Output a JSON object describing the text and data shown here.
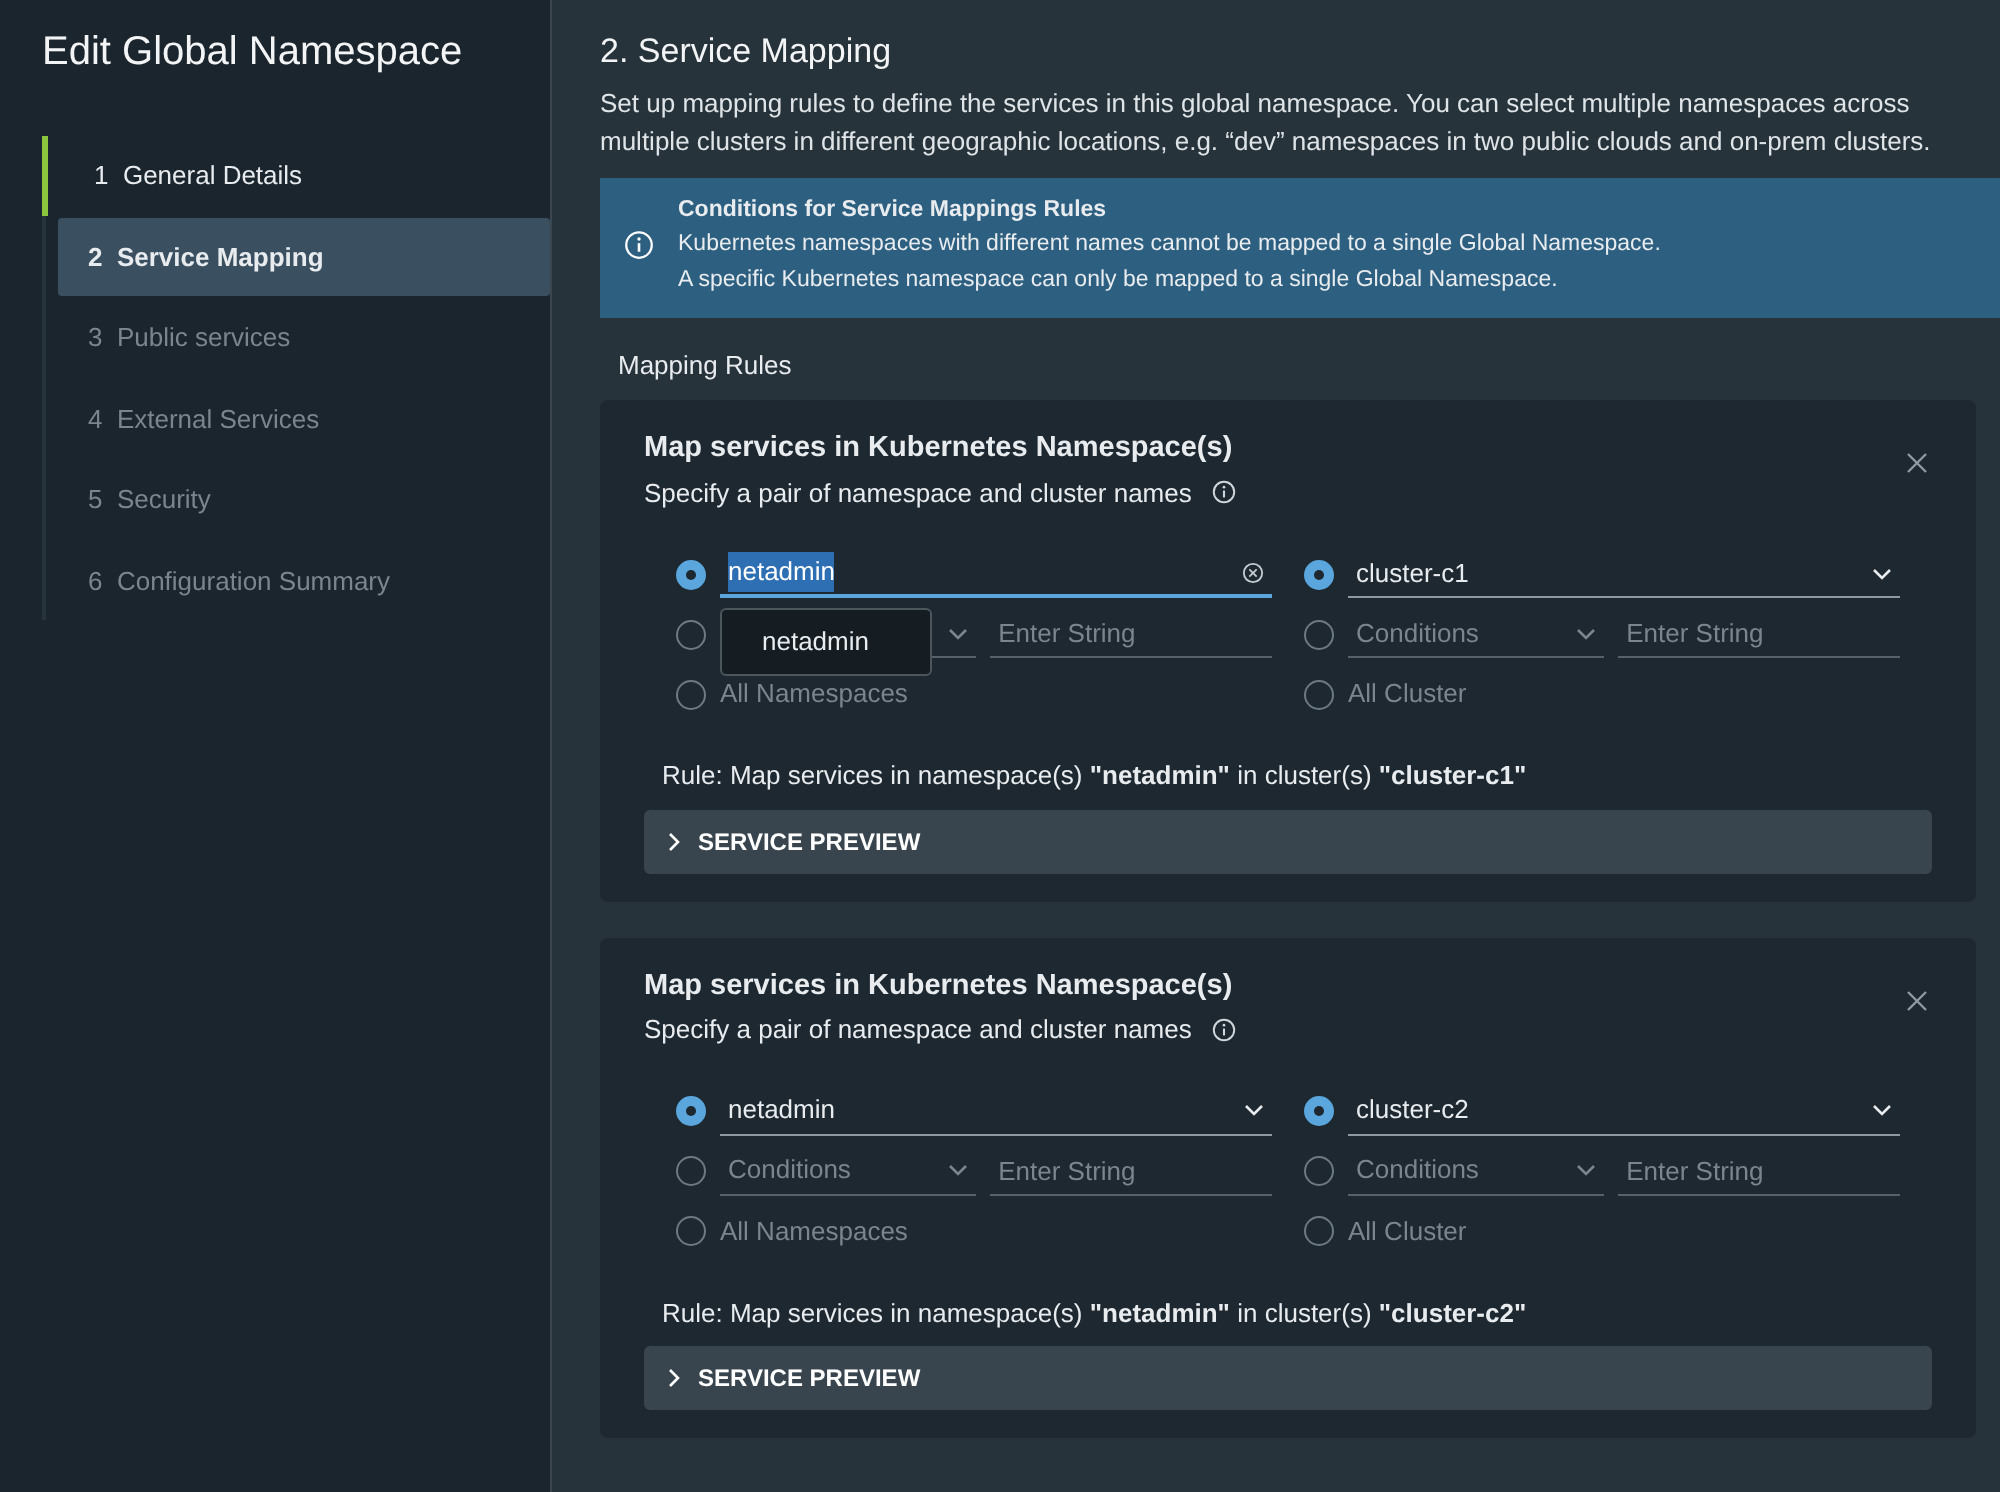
{
  "sidebar": {
    "title": "Edit Global Namespace",
    "steps": [
      {
        "number": "1",
        "label": "General Details",
        "selected": false,
        "completed": true,
        "disabled": false
      },
      {
        "number": "2",
        "label": "Service Mapping",
        "selected": true,
        "completed": false,
        "disabled": false
      },
      {
        "number": "3",
        "label": "Public services",
        "selected": false,
        "completed": false,
        "disabled": true
      },
      {
        "number": "4",
        "label": "External Services",
        "selected": false,
        "completed": false,
        "disabled": true
      },
      {
        "number": "5",
        "label": "Security",
        "selected": false,
        "completed": false,
        "disabled": true
      },
      {
        "number": "6",
        "label": "Configuration Summary",
        "selected": false,
        "completed": false,
        "disabled": true
      }
    ]
  },
  "main": {
    "heading": "2. Service Mapping",
    "description": "Set up mapping rules to define the services in this global namespace. You can select multiple namespaces across multiple clusters in different geographic locations, e.g. “dev” namespaces in two public clouds and on-prem clusters.",
    "alert": {
      "title": "Conditions for Service Mappings Rules",
      "lines": [
        "Kubernetes namespaces with different names cannot be mapped to a single Global Namespace.",
        "A specific Kubernetes namespace can only be mapped to a single Global Namespace."
      ]
    },
    "section_label": "Mapping Rules",
    "rules": [
      {
        "title": "Map services in Kubernetes Namespace(s)",
        "subtitle": "Specify a pair of namespace and cluster names",
        "namespace": {
          "options": [
            {
              "kind": "value",
              "selected": true,
              "value": "netadmin",
              "focused": true,
              "menu_items": [
                "netadmin"
              ]
            },
            {
              "kind": "conditions",
              "selected": false,
              "placeholder": "Enter String"
            },
            {
              "kind": "all",
              "selected": false,
              "label": "All Namespaces"
            }
          ]
        },
        "cluster": {
          "options": [
            {
              "kind": "value",
              "selected": true,
              "value": "cluster-c1",
              "focused": false
            },
            {
              "kind": "conditions",
              "selected": false,
              "condition_placeholder": "Conditions",
              "placeholder": "Enter String"
            },
            {
              "kind": "all",
              "selected": false,
              "label": "All Cluster"
            }
          ]
        },
        "rule_text": "Rule: Map services in namespace(s) **\"netadmin\"** in cluster(s) **\"cluster-c1\"**",
        "preview_label": "SERVICE PREVIEW"
      },
      {
        "title": "Map services in Kubernetes Namespace(s)",
        "subtitle": "Specify a pair of namespace and cluster names",
        "namespace": {
          "options": [
            {
              "kind": "value",
              "selected": true,
              "value": "netadmin",
              "focused": false
            },
            {
              "kind": "conditions",
              "selected": false,
              "condition_placeholder": "Conditions",
              "placeholder": "Enter String"
            },
            {
              "kind": "all",
              "selected": false,
              "label": "All Namespaces"
            }
          ]
        },
        "cluster": {
          "options": [
            {
              "kind": "value",
              "selected": true,
              "value": "cluster-c2",
              "focused": false
            },
            {
              "kind": "conditions",
              "selected": false,
              "condition_placeholder": "Conditions",
              "placeholder": "Enter String"
            },
            {
              "kind": "all",
              "selected": false,
              "label": "All Cluster"
            }
          ]
        },
        "rule_text": "Rule: Map services in namespace(s) **\"netadmin\"** in cluster(s) **\"cluster-c2\"**",
        "preview_label": "SERVICE PREVIEW"
      }
    ]
  }
}
